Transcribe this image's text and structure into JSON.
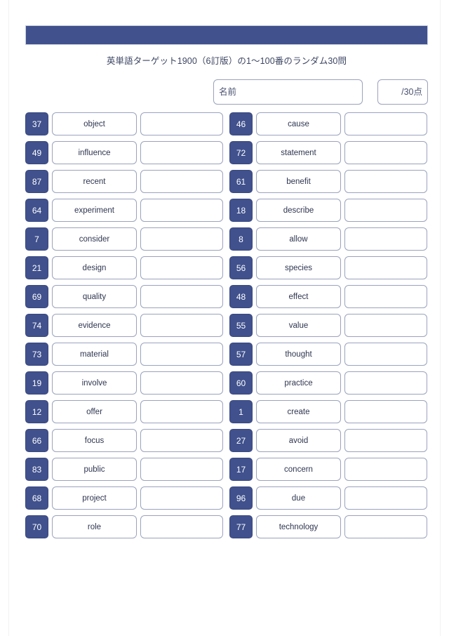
{
  "document": {
    "title": "英単語ターゲット1900（6訂版）の1〜100番のランダム30問",
    "header_bar_color": "#40518d",
    "accent_color": "#40518d",
    "border_color": "#9aa3bd"
  },
  "meta": {
    "name_placeholder": "名前",
    "name_value": "",
    "score_label": "/30点"
  },
  "quiz": {
    "columns": [
      {
        "name": "left-column",
        "rows": [
          {
            "number": "37",
            "word": "object",
            "answer": ""
          },
          {
            "number": "49",
            "word": "influence",
            "answer": ""
          },
          {
            "number": "87",
            "word": "recent",
            "answer": ""
          },
          {
            "number": "64",
            "word": "experiment",
            "answer": ""
          },
          {
            "number": "7",
            "word": "consider",
            "answer": ""
          },
          {
            "number": "21",
            "word": "design",
            "answer": ""
          },
          {
            "number": "69",
            "word": "quality",
            "answer": ""
          },
          {
            "number": "74",
            "word": "evidence",
            "answer": ""
          },
          {
            "number": "73",
            "word": "material",
            "answer": ""
          },
          {
            "number": "19",
            "word": "involve",
            "answer": ""
          },
          {
            "number": "12",
            "word": "offer",
            "answer": ""
          },
          {
            "number": "66",
            "word": "focus",
            "answer": ""
          },
          {
            "number": "83",
            "word": "public",
            "answer": ""
          },
          {
            "number": "68",
            "word": "project",
            "answer": ""
          },
          {
            "number": "70",
            "word": "role",
            "answer": ""
          }
        ]
      },
      {
        "name": "right-column",
        "rows": [
          {
            "number": "46",
            "word": "cause",
            "answer": ""
          },
          {
            "number": "72",
            "word": "statement",
            "answer": ""
          },
          {
            "number": "61",
            "word": "benefit",
            "answer": ""
          },
          {
            "number": "18",
            "word": "describe",
            "answer": ""
          },
          {
            "number": "8",
            "word": "allow",
            "answer": ""
          },
          {
            "number": "56",
            "word": "species",
            "answer": ""
          },
          {
            "number": "48",
            "word": "effect",
            "answer": ""
          },
          {
            "number": "55",
            "word": "value",
            "answer": ""
          },
          {
            "number": "57",
            "word": "thought",
            "answer": ""
          },
          {
            "number": "60",
            "word": "practice",
            "answer": ""
          },
          {
            "number": "1",
            "word": "create",
            "answer": ""
          },
          {
            "number": "27",
            "word": "avoid",
            "answer": ""
          },
          {
            "number": "17",
            "word": "concern",
            "answer": ""
          },
          {
            "number": "96",
            "word": "due",
            "answer": ""
          },
          {
            "number": "77",
            "word": "technology",
            "answer": ""
          }
        ]
      }
    ]
  }
}
